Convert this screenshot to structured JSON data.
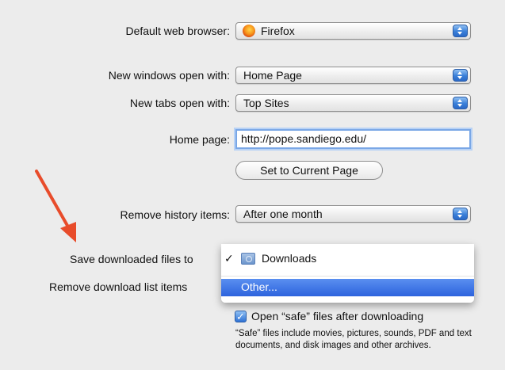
{
  "fields": {
    "default_browser": {
      "label": "Default web browser:",
      "value": "Firefox"
    },
    "new_windows": {
      "label": "New windows open with:",
      "value": "Home Page"
    },
    "new_tabs": {
      "label": "New tabs open with:",
      "value": "Top Sites"
    },
    "home_page": {
      "label": "Home page:",
      "value": "http://pope.sandiego.edu/"
    },
    "set_current_page_button": "Set to Current Page",
    "remove_history": {
      "label": "Remove history items:",
      "value": "After one month"
    },
    "save_downloads": {
      "label": "Save downloaded files to"
    },
    "remove_download_list": {
      "label": "Remove download list items"
    }
  },
  "save_downloads_menu": {
    "items": [
      {
        "check": "✓",
        "label": "Downloads",
        "selected": true,
        "icon": "folder-icon"
      },
      {
        "label": "Other...",
        "highlighted": true
      }
    ]
  },
  "open_safe_files": {
    "checked": true,
    "check_glyph": "✓",
    "label": "Open “safe” files after downloading",
    "note": "“Safe” files include movies, pictures, sounds, PDF and text documents, and disk images and other archives."
  },
  "colors": {
    "background": "#ececec",
    "accent_blue": "#3a7fd8",
    "menu_highlight": "#2d63dd",
    "arrow": "#e84c2b"
  }
}
